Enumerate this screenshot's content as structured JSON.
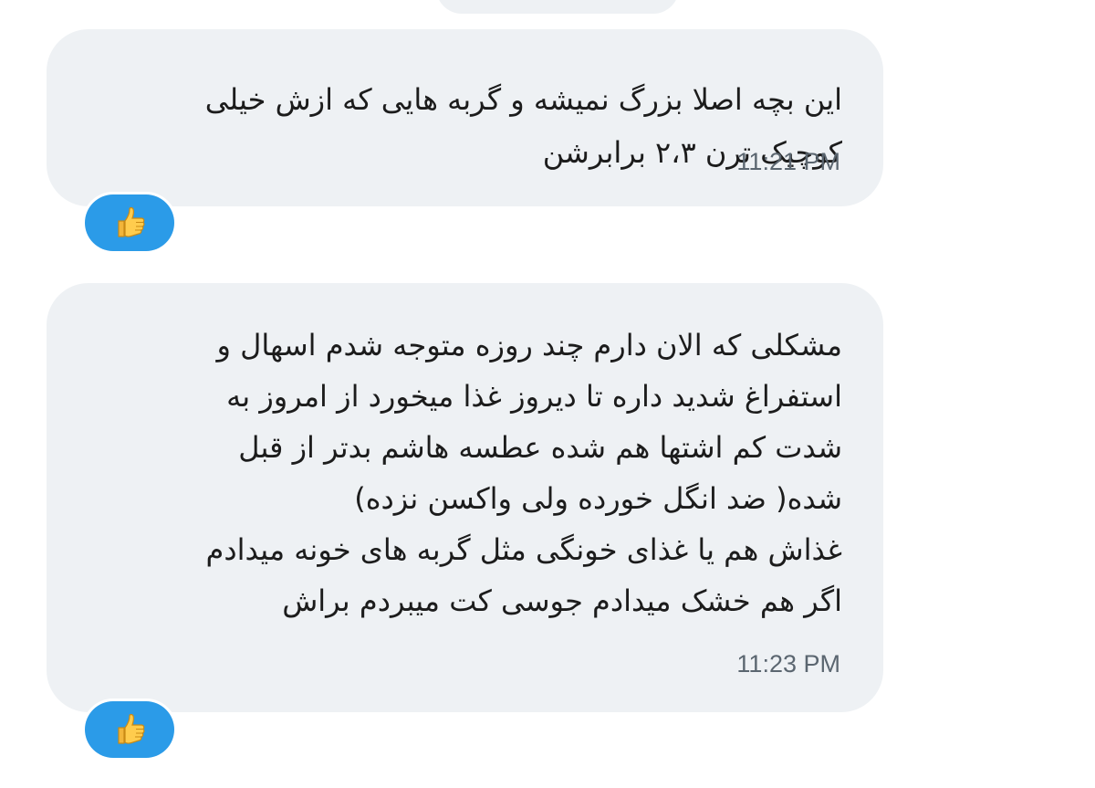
{
  "messages": [
    {
      "text": "این بچه اصلا بزرگ نمیشه و گربه هایی که ازش خیلی\nکوچیک ترن ۲،۳ برابرشن",
      "time": "11:21 PM",
      "reaction_icon": "thumbs-up-icon"
    },
    {
      "text": "مشکلی که الان دارم چند روزه متوجه شدم اسهال و\nاستفراغ شدید داره تا دیروز غذا میخورد از امروز به\nشدت کم اشتها هم شده عطسه هاشم بدتر از قبل\nشده( ضد انگل خورده ولی واکسن نزده)\nغذاش هم یا غذای خونگی مثل گربه های خونه میدادم\nاگر هم خشک میدادم جوسی کت میبردم براش",
      "time": "11:23 PM",
      "reaction_icon": "thumbs-up-icon"
    }
  ],
  "colors": {
    "bubble_background": "#eef1f4",
    "reaction_background": "#2b9be8",
    "timestamp": "#5b6670",
    "text": "#1c1c1c"
  }
}
